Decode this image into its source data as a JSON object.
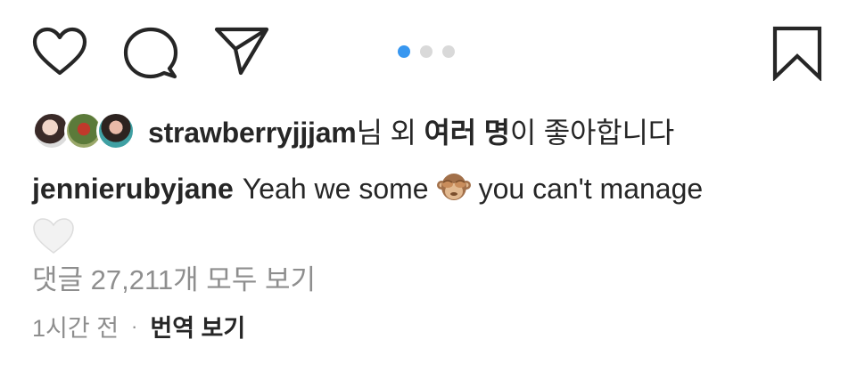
{
  "actions": {
    "like_icon": "heart-outline",
    "comment_icon": "speech-bubble-outline",
    "share_icon": "paper-plane-outline",
    "save_icon": "bookmark-outline"
  },
  "carousel": {
    "total": 3,
    "active": 1,
    "active_color": "#3897f0"
  },
  "likes": {
    "user": "strawberryjjjam",
    "suffix_1": "님 외 ",
    "others": "여러 명",
    "suffix_2": "이 좋아합니다"
  },
  "caption": {
    "user": "jennierubyjane",
    "text_before": "Yeah we some",
    "emoji": "see-no-evil-monkey",
    "text_after": "you can't manage",
    "end_emoji": "white-heart"
  },
  "comments": {
    "view_all": "댓글 27,211개 모두 보기"
  },
  "meta": {
    "time": "1시간 전",
    "separator": "·",
    "translate": "번역 보기"
  }
}
